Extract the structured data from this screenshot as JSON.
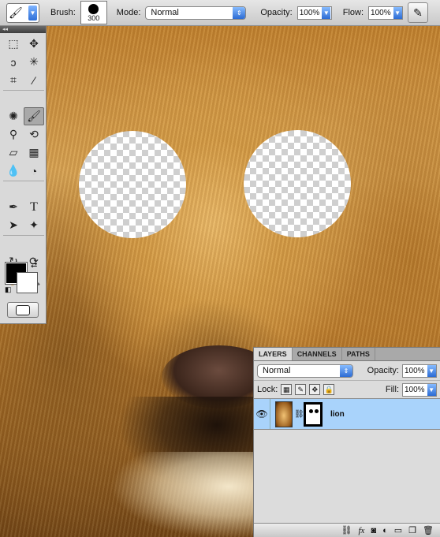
{
  "options_bar": {
    "brush_label": "Brush:",
    "brush_size": "300",
    "mode_label": "Mode:",
    "mode_value": "Normal",
    "opacity_label": "Opacity:",
    "opacity_value": "100%",
    "flow_label": "Flow:",
    "flow_value": "100%"
  },
  "tools": {
    "active_tool": "brush-icon",
    "foreground_color": "#000000",
    "background_color": "#ffffff"
  },
  "layers_panel": {
    "tabs": [
      "LAYERS",
      "CHANNELS",
      "PATHS"
    ],
    "active_tab": "LAYERS",
    "blend_mode": "Normal",
    "opacity_label": "Opacity:",
    "opacity_value": "100%",
    "lock_label": "Lock:",
    "fill_label": "Fill:",
    "fill_value": "100%",
    "layers": [
      {
        "name": "lion",
        "visible": true,
        "selected": true,
        "has_mask": true
      }
    ]
  }
}
